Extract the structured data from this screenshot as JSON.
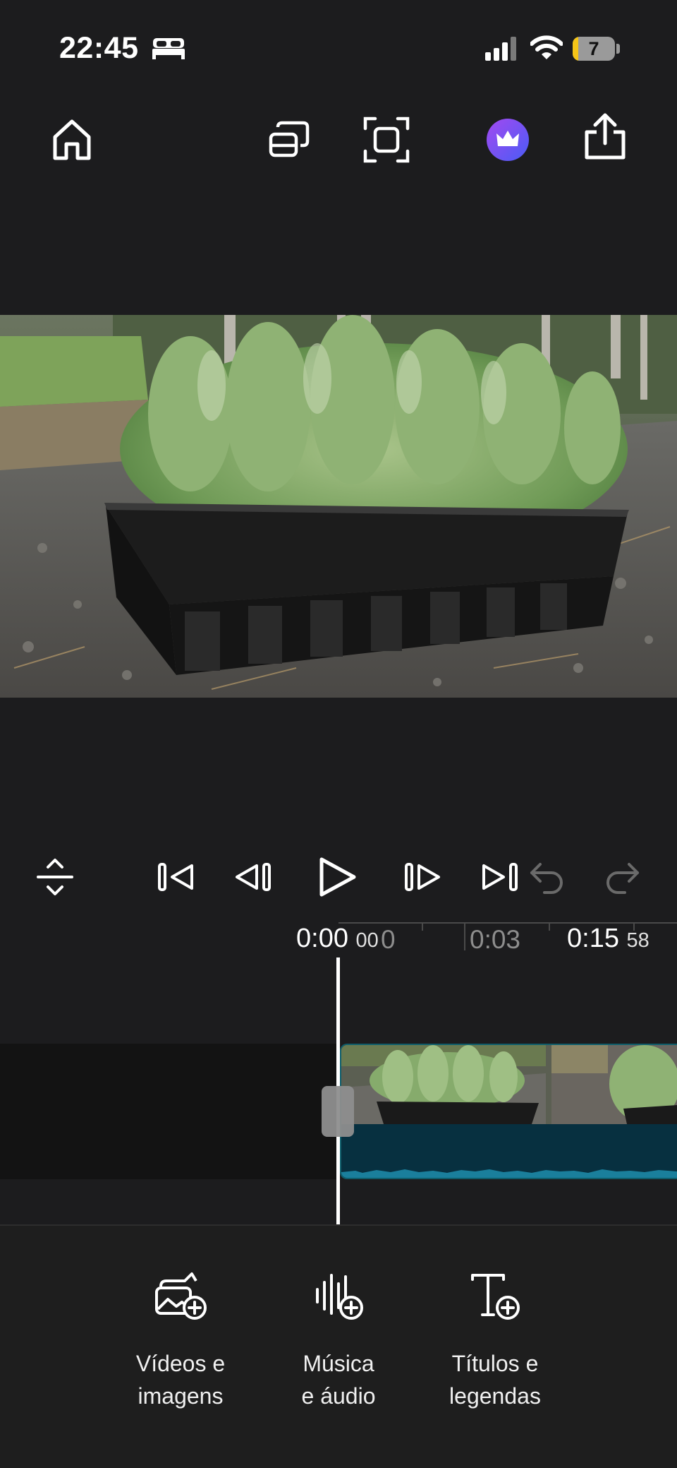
{
  "status_bar": {
    "time": "22:45",
    "battery_level": "7",
    "icons": [
      "bed-icon",
      "signal-icon",
      "wifi-icon",
      "battery-icon"
    ]
  },
  "toolbar": {
    "icons": [
      "home-icon",
      "cast-icon",
      "fullscreen-icon",
      "crown-icon",
      "share-icon"
    ],
    "accent": "#6f4df2"
  },
  "preview": {
    "icons": [
      "lavender-plants-image"
    ]
  },
  "playback": {
    "icons": [
      "expand-collapse-icon",
      "skip-to-start-icon",
      "frame-back-icon",
      "play-icon",
      "frame-forward-icon",
      "skip-to-end-icon",
      "undo-icon",
      "redo-icon"
    ]
  },
  "timeline": {
    "current_time": "0:00",
    "current_frames": "00",
    "tick_0": "0",
    "tick_3": "0:03",
    "total_time": "0:15",
    "total_frames": "58",
    "audio_color": "#073040",
    "clip_border": "#0e5d6b"
  },
  "add_panel": {
    "media_label": "Vídeos e\nimagens",
    "music_label": "Música\ne áudio",
    "titles_label": "Títulos e\nlegendas",
    "icons": [
      "add-image-icon",
      "add-audio-icon",
      "add-title-icon"
    ]
  }
}
